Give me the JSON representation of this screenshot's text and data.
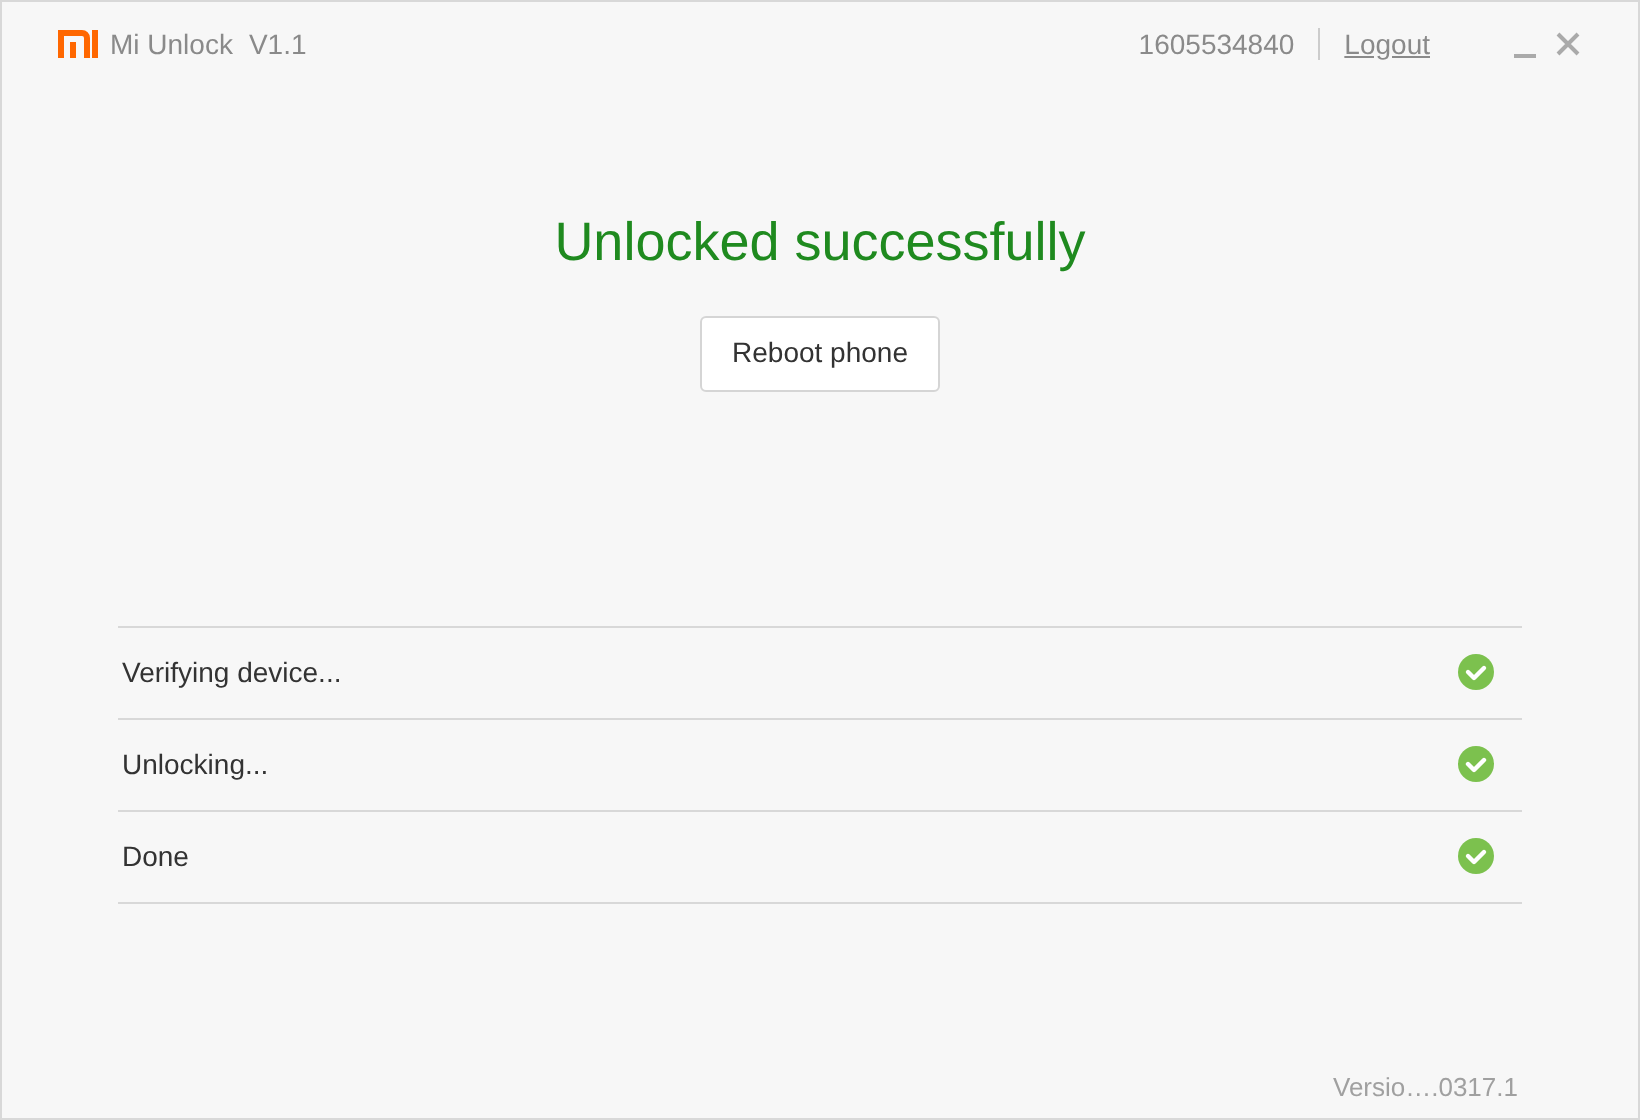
{
  "window": {
    "app_name": "Mi Unlock",
    "version": "V1.1",
    "account": "1605534840",
    "logout": "Logout"
  },
  "result": {
    "title": "Unlocked successfully",
    "button": "Reboot phone"
  },
  "steps": [
    {
      "label": "Verifying device...",
      "done": true
    },
    {
      "label": "Unlocking...",
      "done": true
    },
    {
      "label": "Done",
      "done": true
    }
  ],
  "footer": {
    "version": "Versio….0317.1"
  }
}
